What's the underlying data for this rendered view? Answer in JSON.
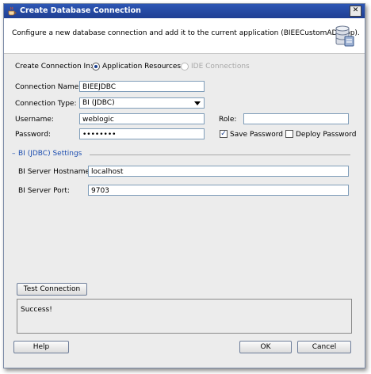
{
  "window": {
    "title": "Create Database Connection",
    "close_glyph": "✕"
  },
  "header": {
    "description": "Configure a new database connection and add it to the current application (BIEECustomADFApp)."
  },
  "form": {
    "create_in_label": "Create Connection In:",
    "option_app_resources": "Application Resources",
    "option_ide_connections": "IDE Connections",
    "connection_name_label": "Connection Name:",
    "connection_name_value": "BIEEJDBC",
    "connection_type_label": "Connection Type:",
    "connection_type_value": "BI (JDBC)",
    "username_label": "Username:",
    "username_value": "weblogic",
    "role_label": "Role:",
    "role_value": "",
    "password_label": "Password:",
    "password_value": "••••••••",
    "save_password_label": "Save Password",
    "save_password_checked": true,
    "deploy_password_label": "Deploy Password",
    "deploy_password_checked": false
  },
  "section": {
    "title": "BI (JDBC) Settings",
    "hostname_label": "BI Server Hostname:",
    "hostname_value": "localhost",
    "port_label": "BI Server Port:",
    "port_value": "9703"
  },
  "test": {
    "button_label": "Test Connection",
    "result_text": "Success!"
  },
  "footer": {
    "help_label": "Help",
    "ok_label": "OK",
    "cancel_label": "Cancel"
  },
  "colors": {
    "titlebar": "#2d56b4",
    "accent": "#1a3f8f",
    "section_title": "#1e4fb0"
  }
}
